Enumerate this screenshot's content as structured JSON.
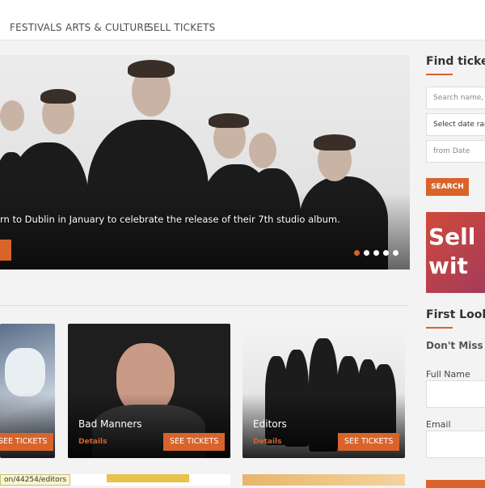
{
  "nav": {
    "items": [
      "FESTIVALS",
      "ARTS & CULTURE",
      "SELL TICKETS"
    ]
  },
  "hero": {
    "caption": "rn to Dublin in January to celebrate the release of their 7th studio album.",
    "slide_count": 5,
    "active_slide": 0
  },
  "cards": [
    {
      "title": "",
      "details": "",
      "button": "SEE TICKETS"
    },
    {
      "title": "Bad Manners",
      "details": "Details",
      "button": "SEE TICKETS"
    },
    {
      "title": "Editors",
      "details": "Details",
      "button": "SEE TICKETS"
    }
  ],
  "sidebar": {
    "find_heading": "Find ticket",
    "search_placeholder": "Search name, r",
    "date_select": "Select date ran",
    "from_date_placeholder": "from Date",
    "search_button": "SEARCH",
    "promo_lines": [
      "Sell",
      "wit"
    ],
    "first_look_heading": "First Look",
    "dont_miss": "Don't Miss Th",
    "full_name_label": "Full Name",
    "email_label": "Email"
  },
  "statusbar": {
    "url": "on/44254/editors"
  },
  "colors": {
    "accent": "#d8642b",
    "nav_text": "#4d4d4d",
    "background": "#f3f3f4"
  }
}
